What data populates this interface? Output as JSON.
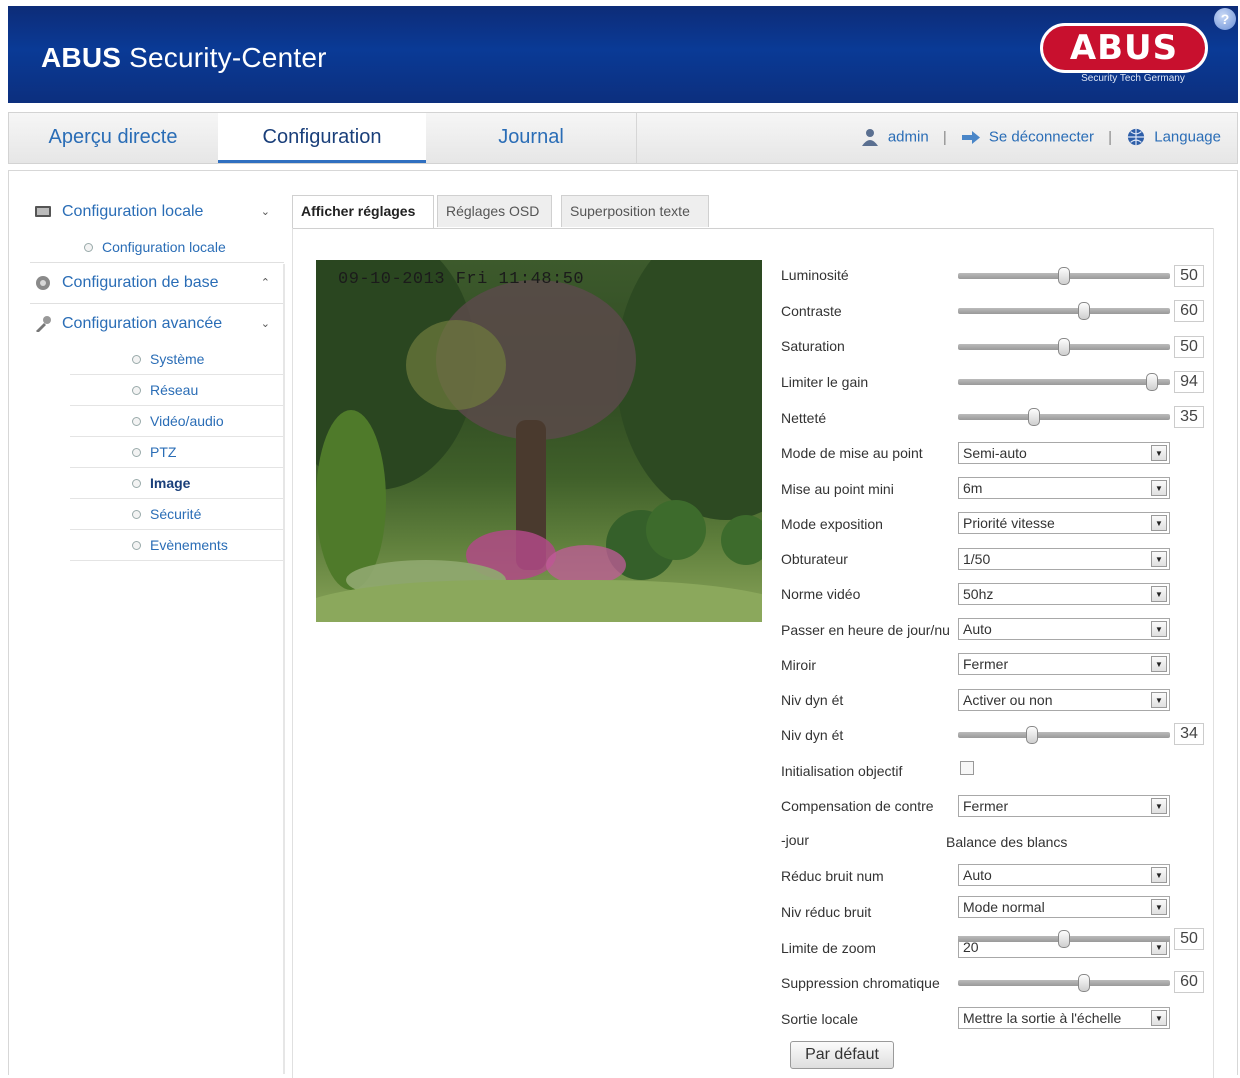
{
  "header": {
    "brand_bold": "ABUS",
    "brand_rest": " Security-Center",
    "logo_text": "ABUS",
    "logo_tagline": "Security Tech Germany",
    "help_icon": "?"
  },
  "nav": {
    "tabs": [
      {
        "label": "Aperçu directe",
        "active": false
      },
      {
        "label": "Configuration",
        "active": true
      },
      {
        "label": "Journal",
        "active": false
      }
    ],
    "user": "admin",
    "logout": "Se déconnecter",
    "language": "Language"
  },
  "sidebar": {
    "local_group": "Configuration locale",
    "local_item": "Configuration locale",
    "base_group": "Configuration de base",
    "advanced_group": "Configuration avancée",
    "advanced_items": [
      "Système",
      "Réseau",
      "Vidéo/audio",
      "PTZ",
      "Image",
      "Sécurité",
      "Evènements"
    ],
    "active_item": "Image"
  },
  "tabs": [
    "Afficher réglages",
    "Réglages OSD",
    "Superposition texte"
  ],
  "preview": {
    "osd_text": "09-10-2013 Fri 11:48:50"
  },
  "settings": {
    "luminosite": {
      "label": "Luminosité",
      "value": "50"
    },
    "contraste": {
      "label": "Contraste",
      "value": "60"
    },
    "saturation": {
      "label": "Saturation",
      "value": "50"
    },
    "gain": {
      "label": "Limiter le gain",
      "value": "94"
    },
    "nettete": {
      "label": "Netteté",
      "value": "35"
    },
    "focus_mode": {
      "label": "Mode de mise au point",
      "value": "Semi-auto"
    },
    "min_focus": {
      "label": "Mise au point mini",
      "value": "6m"
    },
    "exposure": {
      "label": "Mode exposition",
      "value": "Priorité vitesse"
    },
    "shutter": {
      "label": "Obturateur",
      "value": "1/50"
    },
    "video_std": {
      "label": "Norme vidéo",
      "value": "50hz"
    },
    "daynight": {
      "label": "Passer en heure de jour/nu",
      "value": "Auto"
    },
    "mirror": {
      "label": "Miroir",
      "value": "Fermer"
    },
    "wdr_mode": {
      "label": "Niv dyn ét",
      "value": "Activer ou non"
    },
    "wdr_level": {
      "label": "Niv dyn ét",
      "value": "34"
    },
    "lens_init": {
      "label": "Initialisation objectif"
    },
    "backlight": {
      "label": "Compensation de contre",
      "value": "Fermer"
    },
    "jour_label": "-jour",
    "white_balance": "Balance des blancs",
    "dnr": {
      "label": "Réduc bruit num",
      "value": "Auto"
    },
    "dnr_level": {
      "label": "Niv réduc bruit",
      "value": "Mode normal"
    },
    "zoom_limit": {
      "label": "Limite de zoom",
      "select_value": "20",
      "value": "50"
    },
    "chroma": {
      "label": "Suppression chromatique",
      "value": "60"
    },
    "local_out": {
      "label": "Sortie locale",
      "value": "Mettre la sortie à l'échelle"
    }
  },
  "default_button": "Par défaut",
  "slider_levels": {
    "luminosite": 0.5,
    "contraste": 0.6,
    "saturation": 0.5,
    "gain": 0.94,
    "nettete": 0.35,
    "wdr_level": 0.34,
    "zoom_limit": 0.5,
    "chroma": 0.6
  }
}
